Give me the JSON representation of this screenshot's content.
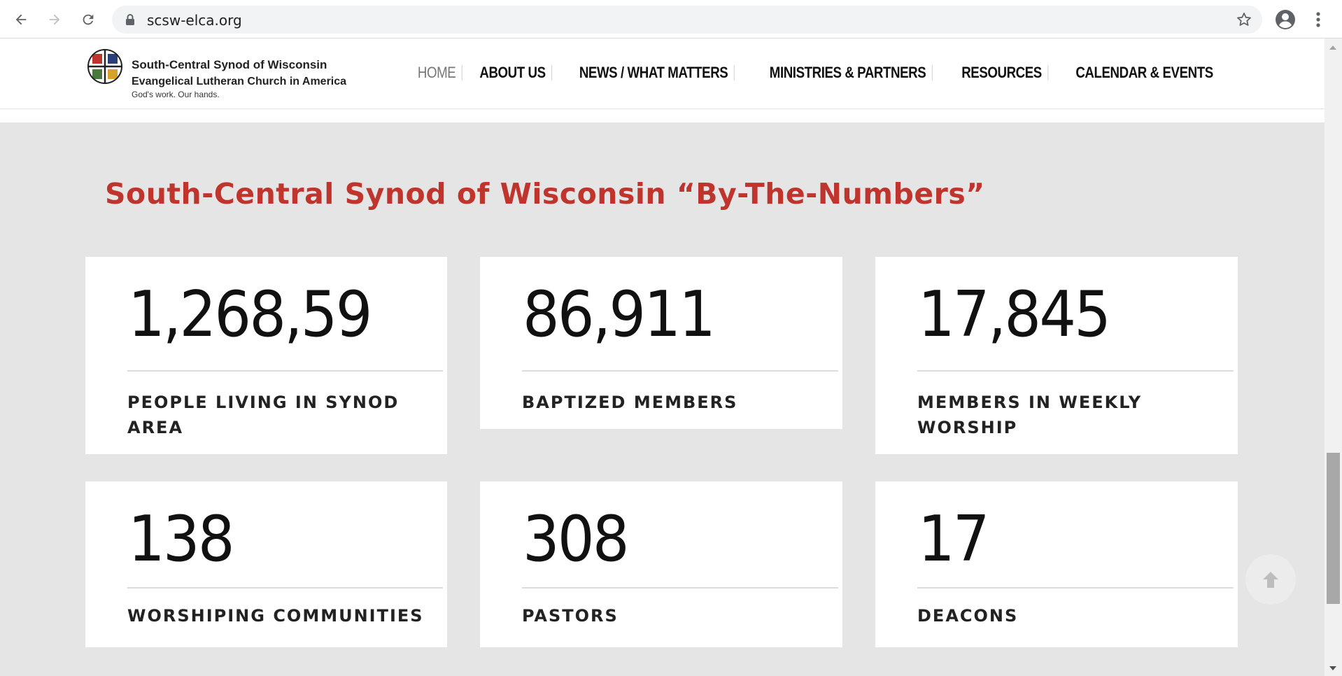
{
  "browser": {
    "url": "scsw-elca.org",
    "icons": [
      "back-arrow-icon",
      "forward-arrow-icon",
      "reload-icon",
      "lock-icon",
      "star-icon",
      "profile-icon",
      "menu-icon"
    ]
  },
  "header": {
    "brand_line1": "South-Central Synod of Wisconsin",
    "brand_line2": "Evangelical Lutheran Church in America",
    "brand_line3": "God's work. Our hands.",
    "nav": [
      {
        "label": "HOME",
        "active": true
      },
      {
        "label": "ABOUT US"
      },
      {
        "label": "NEWS / WHAT MATTERS"
      },
      {
        "label": "MINISTRIES & PARTNERS"
      },
      {
        "label": "RESOURCES"
      },
      {
        "label": "CALENDAR & EVENTS"
      }
    ]
  },
  "main": {
    "title": "South-Central Synod of Wisconsin “By-The-Numbers”",
    "stats": [
      {
        "value": "1,268,59",
        "label_line1": "PEOPLE LIVING IN SYNOD",
        "label_line2": "AREA"
      },
      {
        "value": "86,911",
        "label_line1": "BAPTIZED MEMBERS",
        "label_line2": ""
      },
      {
        "value": "17,845",
        "label_line1": "MEMBERS IN WEEKLY",
        "label_line2": "WORSHIP"
      },
      {
        "value": "138",
        "label_line1": "WORSHIPING COMMUNITIES",
        "label_line2": ""
      },
      {
        "value": "308",
        "label_line1": "PASTORS",
        "label_line2": ""
      },
      {
        "value": "17",
        "label_line1": "DEACONS",
        "label_line2": ""
      }
    ]
  },
  "colors": {
    "accent": "#c0342e",
    "content_bg": "#e5e5e5"
  }
}
